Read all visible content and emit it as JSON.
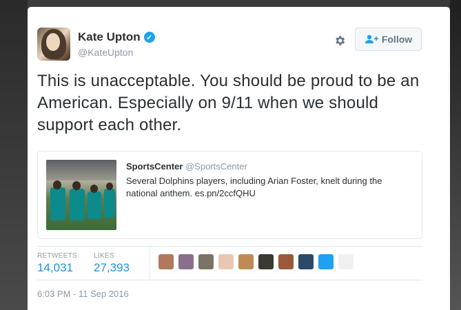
{
  "author": {
    "name": "Kate Upton",
    "handle": "@KateUpton",
    "verified": true
  },
  "follow_label": "Follow",
  "tweet_text": "This is unacceptable. You should be proud to be an American. Especially on 9/11 when we should support each other.",
  "quote": {
    "user": "SportsCenter",
    "handle": "@SportsCenter",
    "text": "Several Dolphins players, including Arian Foster, knelt during the national anthem. es.pn/2ccfQHU"
  },
  "stats": {
    "retweets_label": "RETWEETS",
    "retweets": "14,031",
    "likes_label": "LIKES",
    "likes": "27,393"
  },
  "liker_avatars": [
    {
      "name": "liker-avatar-1",
      "color": "#b07a5a"
    },
    {
      "name": "liker-avatar-2",
      "color": "#8a6f8a"
    },
    {
      "name": "liker-avatar-3",
      "color": "#7b7466"
    },
    {
      "name": "liker-avatar-4",
      "color": "#e8c9b0"
    },
    {
      "name": "liker-avatar-5",
      "color": "#c08a55"
    },
    {
      "name": "liker-avatar-6",
      "color": "#3a3a30"
    },
    {
      "name": "liker-avatar-7",
      "color": "#9a5a3a"
    },
    {
      "name": "liker-avatar-8",
      "color": "#2a4a6a"
    },
    {
      "name": "liker-avatar-9",
      "color": "#1da1f2"
    },
    {
      "name": "liker-avatar-10",
      "color": "#f0f0f0"
    }
  ],
  "timestamp": "6:03 PM - 11 Sep 2016",
  "colors": {
    "accent": "#1b95e0",
    "verified": "#1da1f2",
    "text": "#292f33",
    "muted": "#8899a6"
  },
  "icons": [
    "verified-badge-icon",
    "gear-icon",
    "add-user-icon"
  ]
}
